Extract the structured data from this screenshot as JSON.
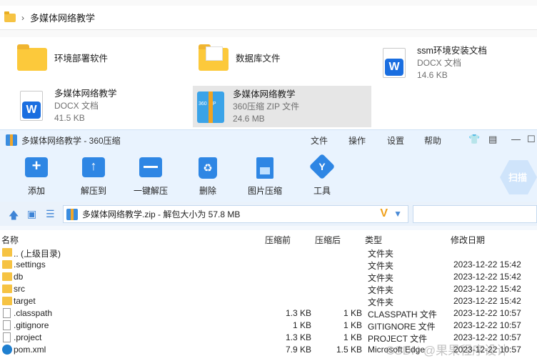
{
  "explorer": {
    "breadcrumb": "多媒体网络教学",
    "tiles": [
      {
        "name": "环境部署软件",
        "type": "",
        "size": ""
      },
      {
        "name": "数据库文件",
        "type": "",
        "size": ""
      },
      {
        "name": "ssm环境安装文档",
        "type": "DOCX 文档",
        "size": "14.6 KB"
      },
      {
        "name": "多媒体网络教学",
        "type": "DOCX 文档",
        "size": "41.5 KB"
      },
      {
        "name": "多媒体网络教学",
        "type": "360压缩 ZIP 文件",
        "size": "24.6 MB",
        "icon_text": "360 ZIP"
      }
    ]
  },
  "window": {
    "title": "多媒体网络教学 - 360压缩",
    "menu": [
      "文件",
      "操作",
      "设置",
      "帮助"
    ],
    "toolbar": [
      "添加",
      "解压到",
      "一键解压",
      "删除",
      "图片压缩",
      "工具"
    ],
    "scan": "扫描",
    "path": "多媒体网络教学.zip - 解包大小为 57.8 MB"
  },
  "columns": {
    "name": "名称",
    "size": "压缩前",
    "packed": "压缩后",
    "type": "类型",
    "date": "修改日期"
  },
  "rows": [
    {
      "name": ".. (上级目录)",
      "size": "",
      "packed": "",
      "type": "文件夹",
      "date": ""
    },
    {
      "name": ".settings",
      "size": "",
      "packed": "",
      "type": "文件夹",
      "date": "2023-12-22 15:42"
    },
    {
      "name": "db",
      "size": "",
      "packed": "",
      "type": "文件夹",
      "date": "2023-12-22 15:42"
    },
    {
      "name": "src",
      "size": "",
      "packed": "",
      "type": "文件夹",
      "date": "2023-12-22 15:42"
    },
    {
      "name": "target",
      "size": "",
      "packed": "",
      "type": "文件夹",
      "date": "2023-12-22 15:42"
    },
    {
      "name": ".classpath",
      "size": "1.3 KB",
      "packed": "1 KB",
      "type": "CLASSPATH 文件",
      "date": "2023-12-22 10:57"
    },
    {
      "name": ".gitignore",
      "size": "1 KB",
      "packed": "1 KB",
      "type": "GITIGNORE 文件",
      "date": "2023-12-22 10:57"
    },
    {
      "name": ".project",
      "size": "1.3 KB",
      "packed": "1 KB",
      "type": "PROJECT 文件",
      "date": "2023-12-22 10:57"
    },
    {
      "name": "pom.xml",
      "size": "7.9 KB",
      "packed": "1.5 KB",
      "type": "Microsoft Edge",
      "date": "2023-12-22 10:57"
    }
  ],
  "watermark": "CSDN @果果程序设计"
}
